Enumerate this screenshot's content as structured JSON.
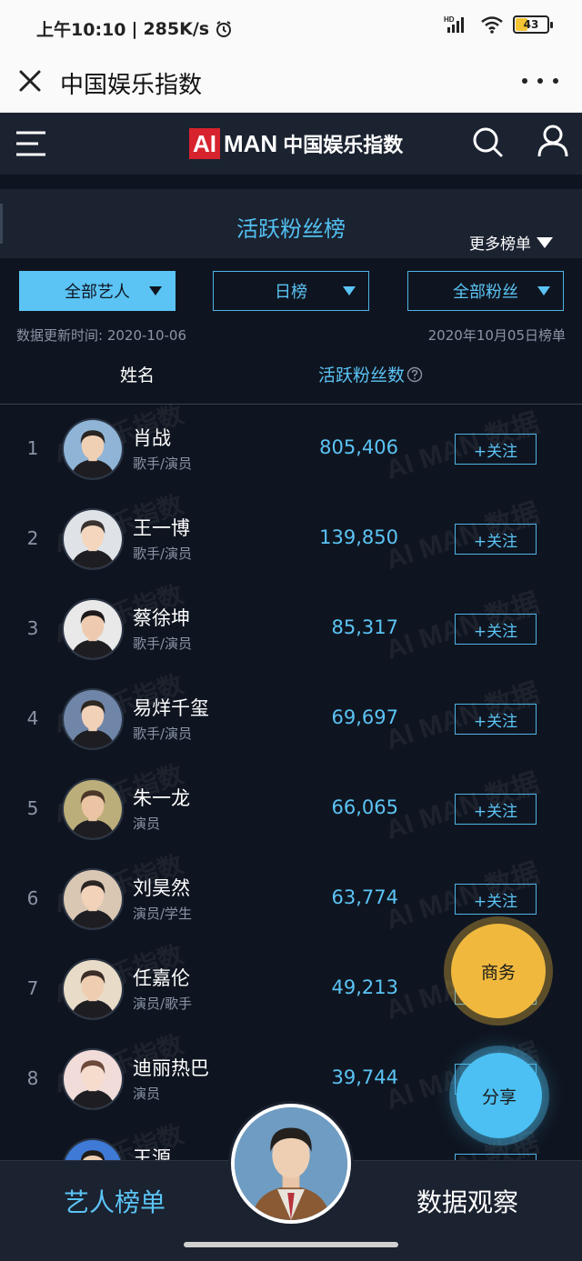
{
  "status_bar": {
    "time": "上午10:10",
    "speed": "285K/s",
    "network_label": "HD",
    "battery": "43"
  },
  "title_bar": {
    "title": "中国娱乐指数"
  },
  "app": {
    "logo_ai": "AI",
    "logo_man": "MAN",
    "logo_cn": "中国娱乐指数",
    "board_title": "活跃粉丝榜",
    "more_boards": "更多榜单",
    "filters": [
      "全部艺人",
      "日榜",
      "全部粉丝"
    ],
    "update_time": "数据更新时间: 2020-10-06",
    "board_date": "2020年10月05日榜单",
    "col_name": "姓名",
    "col_fans": "活跃粉丝数",
    "follow_label": "+关注",
    "watermark_1": "AI 娱乐指数",
    "watermark_2": "AI MAN 数据",
    "rows": [
      {
        "rank": "1",
        "name": "肖战",
        "role": "歌手/演员",
        "count": "805,406"
      },
      {
        "rank": "2",
        "name": "王一博",
        "role": "歌手/演员",
        "count": "139,850"
      },
      {
        "rank": "3",
        "name": "蔡徐坤",
        "role": "歌手/演员",
        "count": "85,317"
      },
      {
        "rank": "4",
        "name": "易烊千玺",
        "role": "歌手/演员",
        "count": "69,697"
      },
      {
        "rank": "5",
        "name": "朱一龙",
        "role": "演员",
        "count": "66,065"
      },
      {
        "rank": "6",
        "name": "刘昊然",
        "role": "演员/学生",
        "count": "63,774"
      },
      {
        "rank": "7",
        "name": "任嘉伦",
        "role": "演员/歌手",
        "count": "49,213"
      },
      {
        "rank": "8",
        "name": "迪丽热巴",
        "role": "演员",
        "count": "39,744"
      },
      {
        "rank": "",
        "name": "王源",
        "role": "",
        "count": ""
      }
    ],
    "fab_business": "商务",
    "fab_share": "分享",
    "nav_left": "艺人榜单",
    "nav_right": "数据观察"
  },
  "colors": {
    "accent": "#5bc4f5",
    "background": "#0f1520",
    "header": "#1b2230",
    "business": "#f0b93e",
    "logo_red": "#d7232e"
  }
}
